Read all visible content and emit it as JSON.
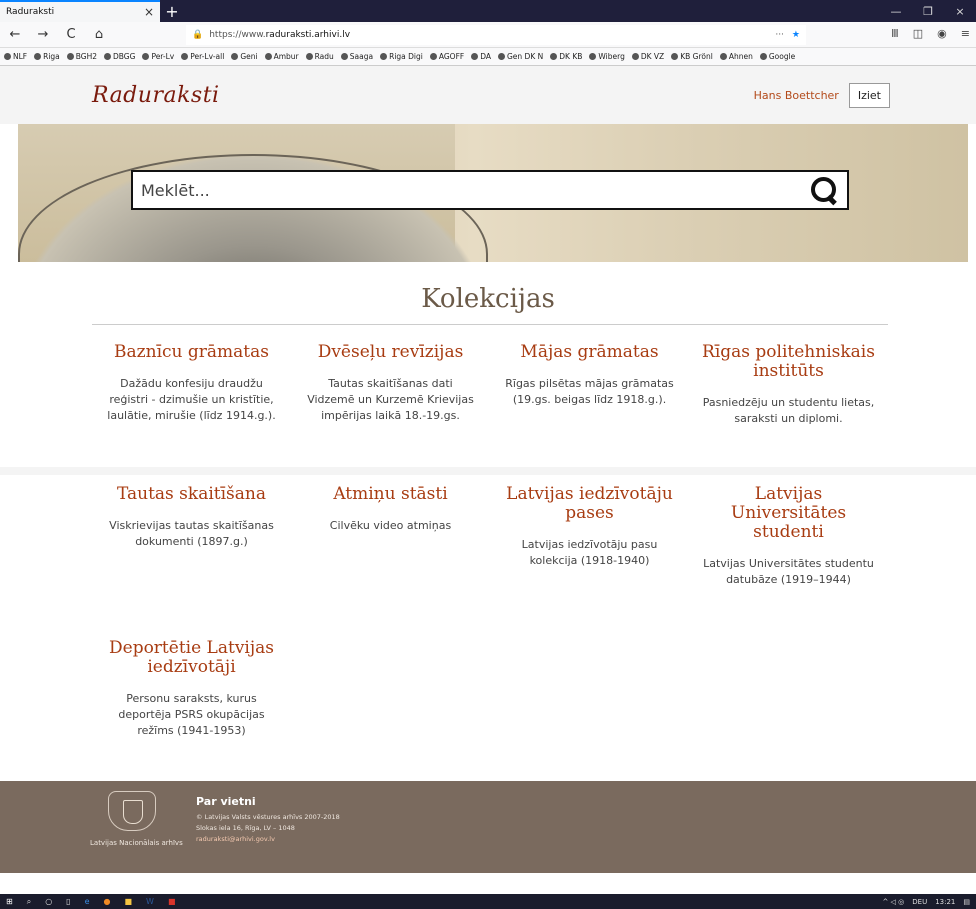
{
  "browser": {
    "tab_title": "Raduraksti",
    "tab_close": "×",
    "new_tab": "+",
    "url_prefix": "https://www.",
    "url_domain": "raduraksti.arhivi.lv",
    "url_menu": "···",
    "min": "—",
    "max": "❐",
    "close": "×",
    "back": "←",
    "forward": "→",
    "reload": "C",
    "home": "⌂"
  },
  "bookmarks": [
    "NLF",
    "Riga",
    "BGH2",
    "DBGG",
    "Per-Lv",
    "Per-Lv-all",
    "Geni",
    "Ambur",
    "Radu",
    "Saaga",
    "Riga Digi",
    "AGOFF",
    "DA",
    "Gen DK N",
    "DK KB",
    "Wiberg",
    "DK VZ",
    "KB Grönl",
    "Ahnen",
    "Google"
  ],
  "header": {
    "logo": "Raduraksti",
    "user_name": "Hans Boettcher",
    "logout_label": "Iziet"
  },
  "search": {
    "placeholder": "Meklēt..."
  },
  "collections": {
    "title": "Kolekcijas",
    "items": [
      {
        "title": "Baznīcu grāmatas",
        "desc": "Dažādu konfesiju draudžu reģistri - dzimušie un kristītie, laulātie, mirušie (līdz 1914.g.)."
      },
      {
        "title": "Dvēseļu revīzijas",
        "desc": "Tautas skaitīšanas dati Vidzemē un Kurzemē Krievijas impērijas laikā 18.-19.gs."
      },
      {
        "title": "Mājas grāmatas",
        "desc": "Rīgas pilsētas mājas grāmatas (19.gs. beigas līdz 1918.g.)."
      },
      {
        "title": "Rīgas politehniskais institūts",
        "desc": "Pasniedzēju un studentu lietas, saraksti un diplomi."
      },
      {
        "title": "Tautas skaitīšana",
        "desc": "Viskrievijas tautas skaitīšanas dokumenti (1897.g.)"
      },
      {
        "title": "Atmiņu stāsti",
        "desc": "Cilvēku video atmiņas"
      },
      {
        "title": "Latvijas iedzīvotāju pases",
        "desc": "Latvijas iedzīvotāju pasu kolekcija (1918-1940)"
      },
      {
        "title": "Latvijas Universitātes studenti",
        "desc": "Latvijas Universitātes studentu datubāze (1919–1944)"
      },
      {
        "title": "Deportētie Latvijas iedzīvotāji",
        "desc": "Personu saraksts, kurus deportēja PSRS okupācijas režīms (1941-1953)"
      }
    ]
  },
  "footer": {
    "org": "Latvijas Nacionālais arhīvs",
    "about_title": "Par vietni",
    "copyright": "© Latvijas Valsts vēstures arhīvs 2007-2018",
    "address": "Slokas iela 16, Rīga, LV – 1048",
    "email": "raduraksti@arhivi.gov.lv"
  },
  "taskbar": {
    "lang": "DEU",
    "time": "13:21"
  }
}
